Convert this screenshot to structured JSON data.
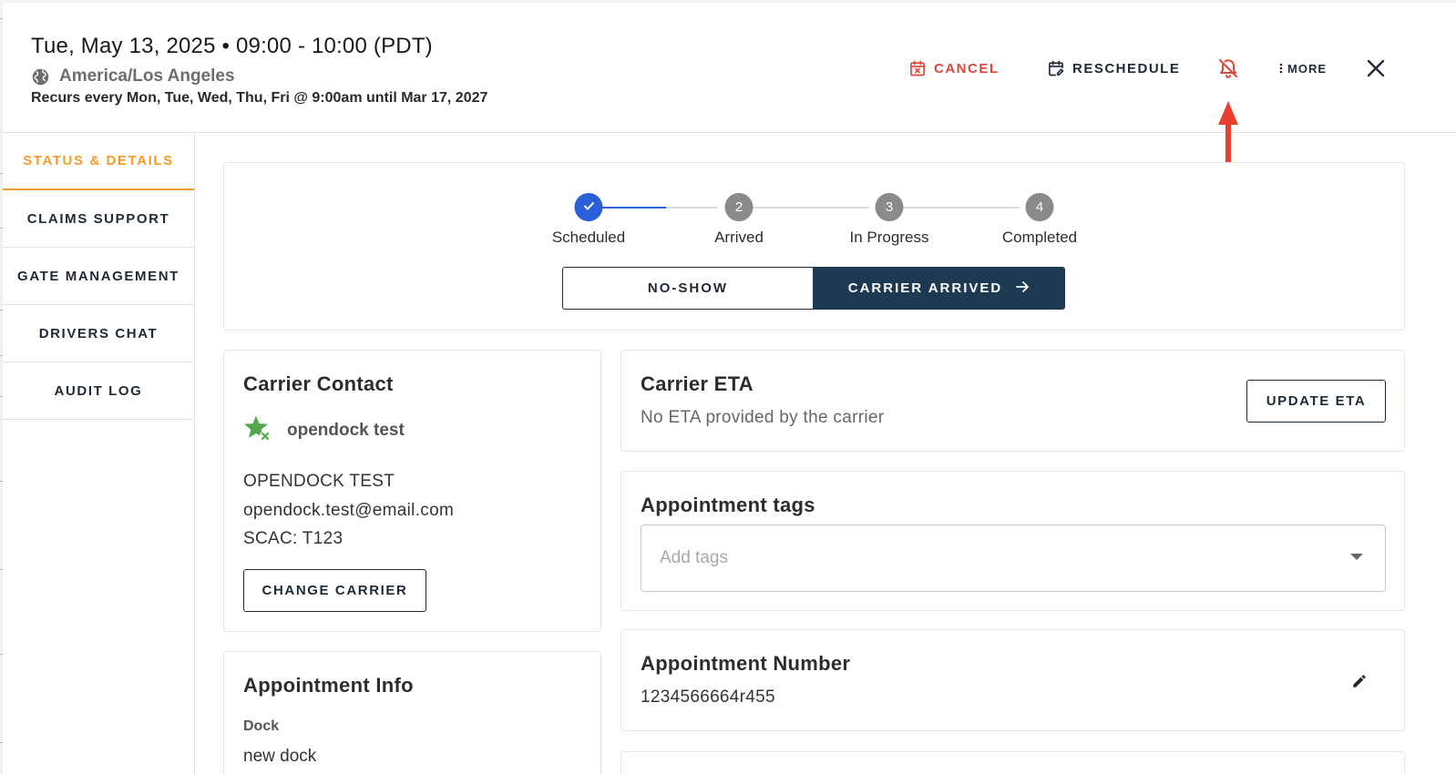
{
  "header": {
    "datetime": "Tue, May 13, 2025 • 09:00 - 10:00 (PDT)",
    "timezone": "America/Los Angeles",
    "recurrence": "Recurs every Mon, Tue, Wed, Thu, Fri @ 9:00am until Mar 17, 2027",
    "actions": {
      "cancel": "CANCEL",
      "reschedule": "RESCHEDULE",
      "more": "MORE"
    }
  },
  "colors": {
    "accent": "#f59a2b",
    "danger": "#e0463a",
    "primary": "#1e3a52",
    "step_active": "#2b5fd9",
    "step_inactive": "#8a8a8a"
  },
  "icons": {
    "timezone": "globe-icon",
    "cancel": "calendar-x-icon",
    "reschedule": "calendar-edit-icon",
    "notifications": "bell-off-icon",
    "more": "dots-vertical-icon",
    "close": "close-icon",
    "carrier": "star-x-icon",
    "edit": "pencil-icon",
    "tags_dropdown": "caret-down-icon"
  },
  "sidebar": {
    "items": [
      {
        "label": "STATUS & DETAILS",
        "active": true
      },
      {
        "label": "CLAIMS SUPPORT",
        "active": false
      },
      {
        "label": "GATE MANAGEMENT",
        "active": false
      },
      {
        "label": "DRIVERS CHAT",
        "active": false
      },
      {
        "label": "AUDIT LOG",
        "active": false
      }
    ]
  },
  "status": {
    "steps": [
      {
        "number": "1",
        "label": "Scheduled",
        "state": "done"
      },
      {
        "number": "2",
        "label": "Arrived",
        "state": "pending"
      },
      {
        "number": "3",
        "label": "In Progress",
        "state": "pending"
      },
      {
        "number": "4",
        "label": "Completed",
        "state": "pending"
      }
    ],
    "no_show_label": "NO-SHOW",
    "carrier_arrived_label": "CARRIER ARRIVED"
  },
  "carrier_contact": {
    "title": "Carrier Contact",
    "company": "opendock test",
    "name": "OPENDOCK TEST",
    "email": "opendock.test@email.com",
    "scac": "SCAC: T123",
    "change_label": "CHANGE CARRIER"
  },
  "carrier_eta": {
    "title": "Carrier ETA",
    "text": "No ETA provided by the carrier",
    "update_label": "UPDATE ETA"
  },
  "appointment_tags": {
    "title": "Appointment tags",
    "placeholder": "Add tags"
  },
  "appointment_number": {
    "title": "Appointment Number",
    "value": "1234566664r455"
  },
  "appointment_info": {
    "title": "Appointment Info",
    "dock_label": "Dock",
    "dock_value": "new dock"
  }
}
